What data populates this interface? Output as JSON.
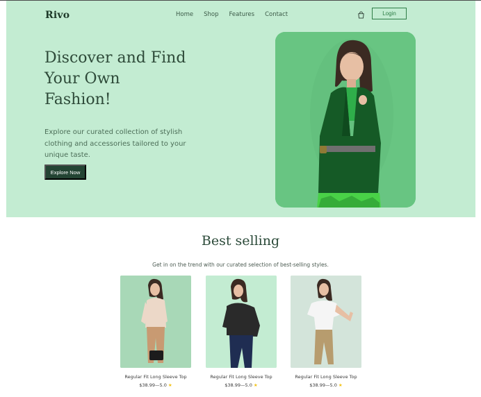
{
  "brand": {
    "logo": "Rivo"
  },
  "nav": {
    "items": [
      "Home",
      "Shop",
      "Features",
      "Contact"
    ]
  },
  "header": {
    "login_label": "Login"
  },
  "hero": {
    "title_line1": "Discover and Find",
    "title_line2": "Your Own",
    "title_line3": "Fashion!",
    "description": "Explore our curated collection of stylish clothing and accessories tailored to your unique taste.",
    "cta_label": "Explore Now"
  },
  "best_selling": {
    "title": "Best selling",
    "subtitle": "Get in on the trend with our curated selection of best-selling styles.",
    "products": [
      {
        "name": "Regular Fit Long Sleeve Top",
        "price": "$38.99",
        "rating": "—5.0",
        "bg": "#a8d8b7"
      },
      {
        "name": "Regular Fit Long Sleeve Top",
        "price": "$38.99",
        "rating": "—5.0",
        "bg": "#c3ecd2"
      },
      {
        "name": "Regular Fit Long Sleeve Top",
        "price": "$38.99",
        "rating": "—5.0",
        "bg": "#d3e4da"
      }
    ]
  },
  "colors": {
    "hero_bg": "#c3ecd2",
    "accent": "#2e7d46",
    "dark": "#234433",
    "star": "#f3c317"
  },
  "icons": {
    "cart": "shopping-bag-icon",
    "star": "star-icon"
  }
}
